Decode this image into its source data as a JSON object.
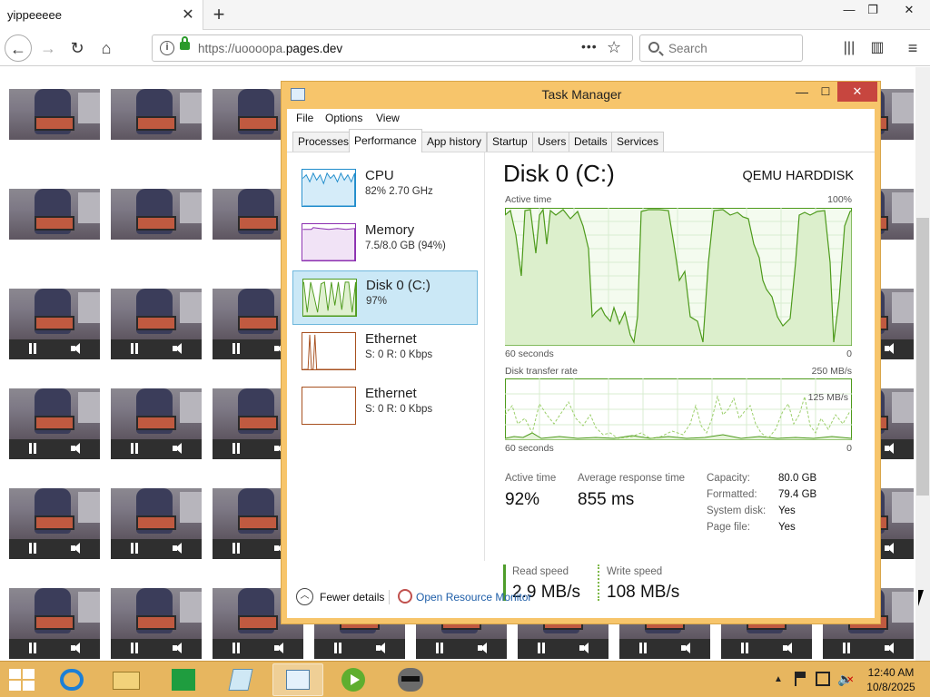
{
  "browser": {
    "tab_title": "yippeeeee",
    "url_prefix": "https://",
    "url_subdomain": "uoooopa.",
    "url_domain": "pages.dev",
    "search_placeholder": "Search"
  },
  "task_manager": {
    "title": "Task Manager",
    "menu": [
      "File",
      "Options",
      "View"
    ],
    "tabs": [
      "Processes",
      "Performance",
      "App history",
      "Startup",
      "Users",
      "Details",
      "Services"
    ],
    "active_tab": "Performance",
    "resources": [
      {
        "name": "CPU",
        "detail": "82%  2.70 GHz",
        "color": "#1f8ccb"
      },
      {
        "name": "Memory",
        "detail": "7.5/8.0 GB (94%)",
        "color": "#8b2fb0"
      },
      {
        "name": "Disk 0 (C:)",
        "detail": "97%",
        "color": "#4d9a1b"
      },
      {
        "name": "Ethernet",
        "detail": "S: 0  R: 0 Kbps",
        "color": "#a7501f"
      },
      {
        "name": "Ethernet",
        "detail": "S: 0  R: 0 Kbps",
        "color": "#a7501f"
      }
    ],
    "disk": {
      "title": "Disk 0 (C:)",
      "model": "QEMU HARDDISK",
      "active_time_label": "Active time",
      "active_time_max": "100%",
      "time_axis_label": "60 seconds",
      "zero": "0",
      "transfer_label": "Disk transfer rate",
      "transfer_max": "250 MB/s",
      "transfer_mid": "125 MB/s",
      "stats": {
        "active_time_label": "Active time",
        "active_time_value": "92%",
        "avg_response_label": "Average response time",
        "avg_response_value": "855 ms",
        "read_speed_label": "Read speed",
        "read_speed_value": "2.9 MB/s",
        "write_speed_label": "Write speed",
        "write_speed_value": "108 MB/s"
      },
      "properties": [
        {
          "key": "Capacity:",
          "value": "80.0 GB"
        },
        {
          "key": "Formatted:",
          "value": "79.4 GB"
        },
        {
          "key": "System disk:",
          "value": "Yes"
        },
        {
          "key": "Page file:",
          "value": "Yes"
        }
      ]
    },
    "footer": {
      "fewer_details": "Fewer details",
      "open_resource_monitor": "Open Resource Monitor"
    }
  },
  "taskbar": {
    "time": "12:40 AM",
    "date": "10/8/2025"
  }
}
